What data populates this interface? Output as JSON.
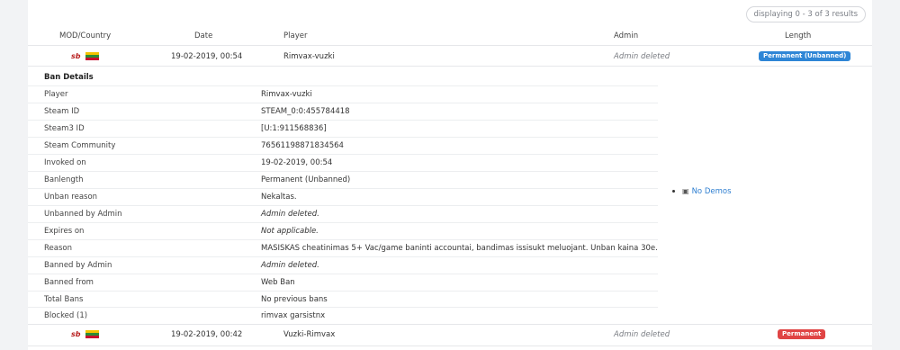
{
  "results_text": "displaying 0 - 3 of 3 results",
  "columns": [
    "MOD/Country",
    "Date",
    "Player",
    "Admin",
    "Length"
  ],
  "rows": [
    {
      "mod_icon": "sb",
      "country_flag": "lithuania-flag",
      "date": "19-02-2019, 00:54",
      "player": "Rimvax-vuzki",
      "admin": "Admin deleted",
      "length": "Permanent (Unbanned)",
      "length_color": "#2f86d6"
    },
    {
      "mod_icon": "sb",
      "country_flag": "lithuania-flag",
      "date": "19-02-2019, 00:42",
      "player": "Vuzki-Rimvax",
      "admin": "Admin deleted",
      "length": "Permanent",
      "length_color": "#e04545"
    }
  ],
  "ban_details": {
    "title": "Ban Details",
    "items": [
      {
        "label": "Player",
        "value": "Rimvax-vuzki"
      },
      {
        "label": "Steam ID",
        "value": "STEAM_0:0:455784418"
      },
      {
        "label": "Steam3 ID",
        "value": "[U:1:911568836]"
      },
      {
        "label": "Steam Community",
        "value": "76561198871834564"
      },
      {
        "label": "Invoked on",
        "value": "19-02-2019, 00:54"
      },
      {
        "label": "Banlength",
        "value": "Permanent (Unbanned)"
      },
      {
        "label": "Unban reason",
        "value": "Nekaltas."
      },
      {
        "label": "Unbanned by Admin",
        "value": "Admin deleted."
      },
      {
        "label": "Expires on",
        "value": "Not applicable."
      },
      {
        "label": "Reason",
        "value": "MASISKAS cheatinimas 5+ Vac/game baninti accountai, bandimas issisukt meluojant. Unban kaina 30e."
      },
      {
        "label": "Banned by Admin",
        "value": "Admin deleted."
      },
      {
        "label": "Banned from",
        "value": "Web Ban"
      },
      {
        "label": "Total Bans",
        "value": "No previous bans"
      },
      {
        "label": "Blocked (1)",
        "value": "rimvax garsistnx"
      }
    ],
    "demos_label": "No Demos"
  }
}
